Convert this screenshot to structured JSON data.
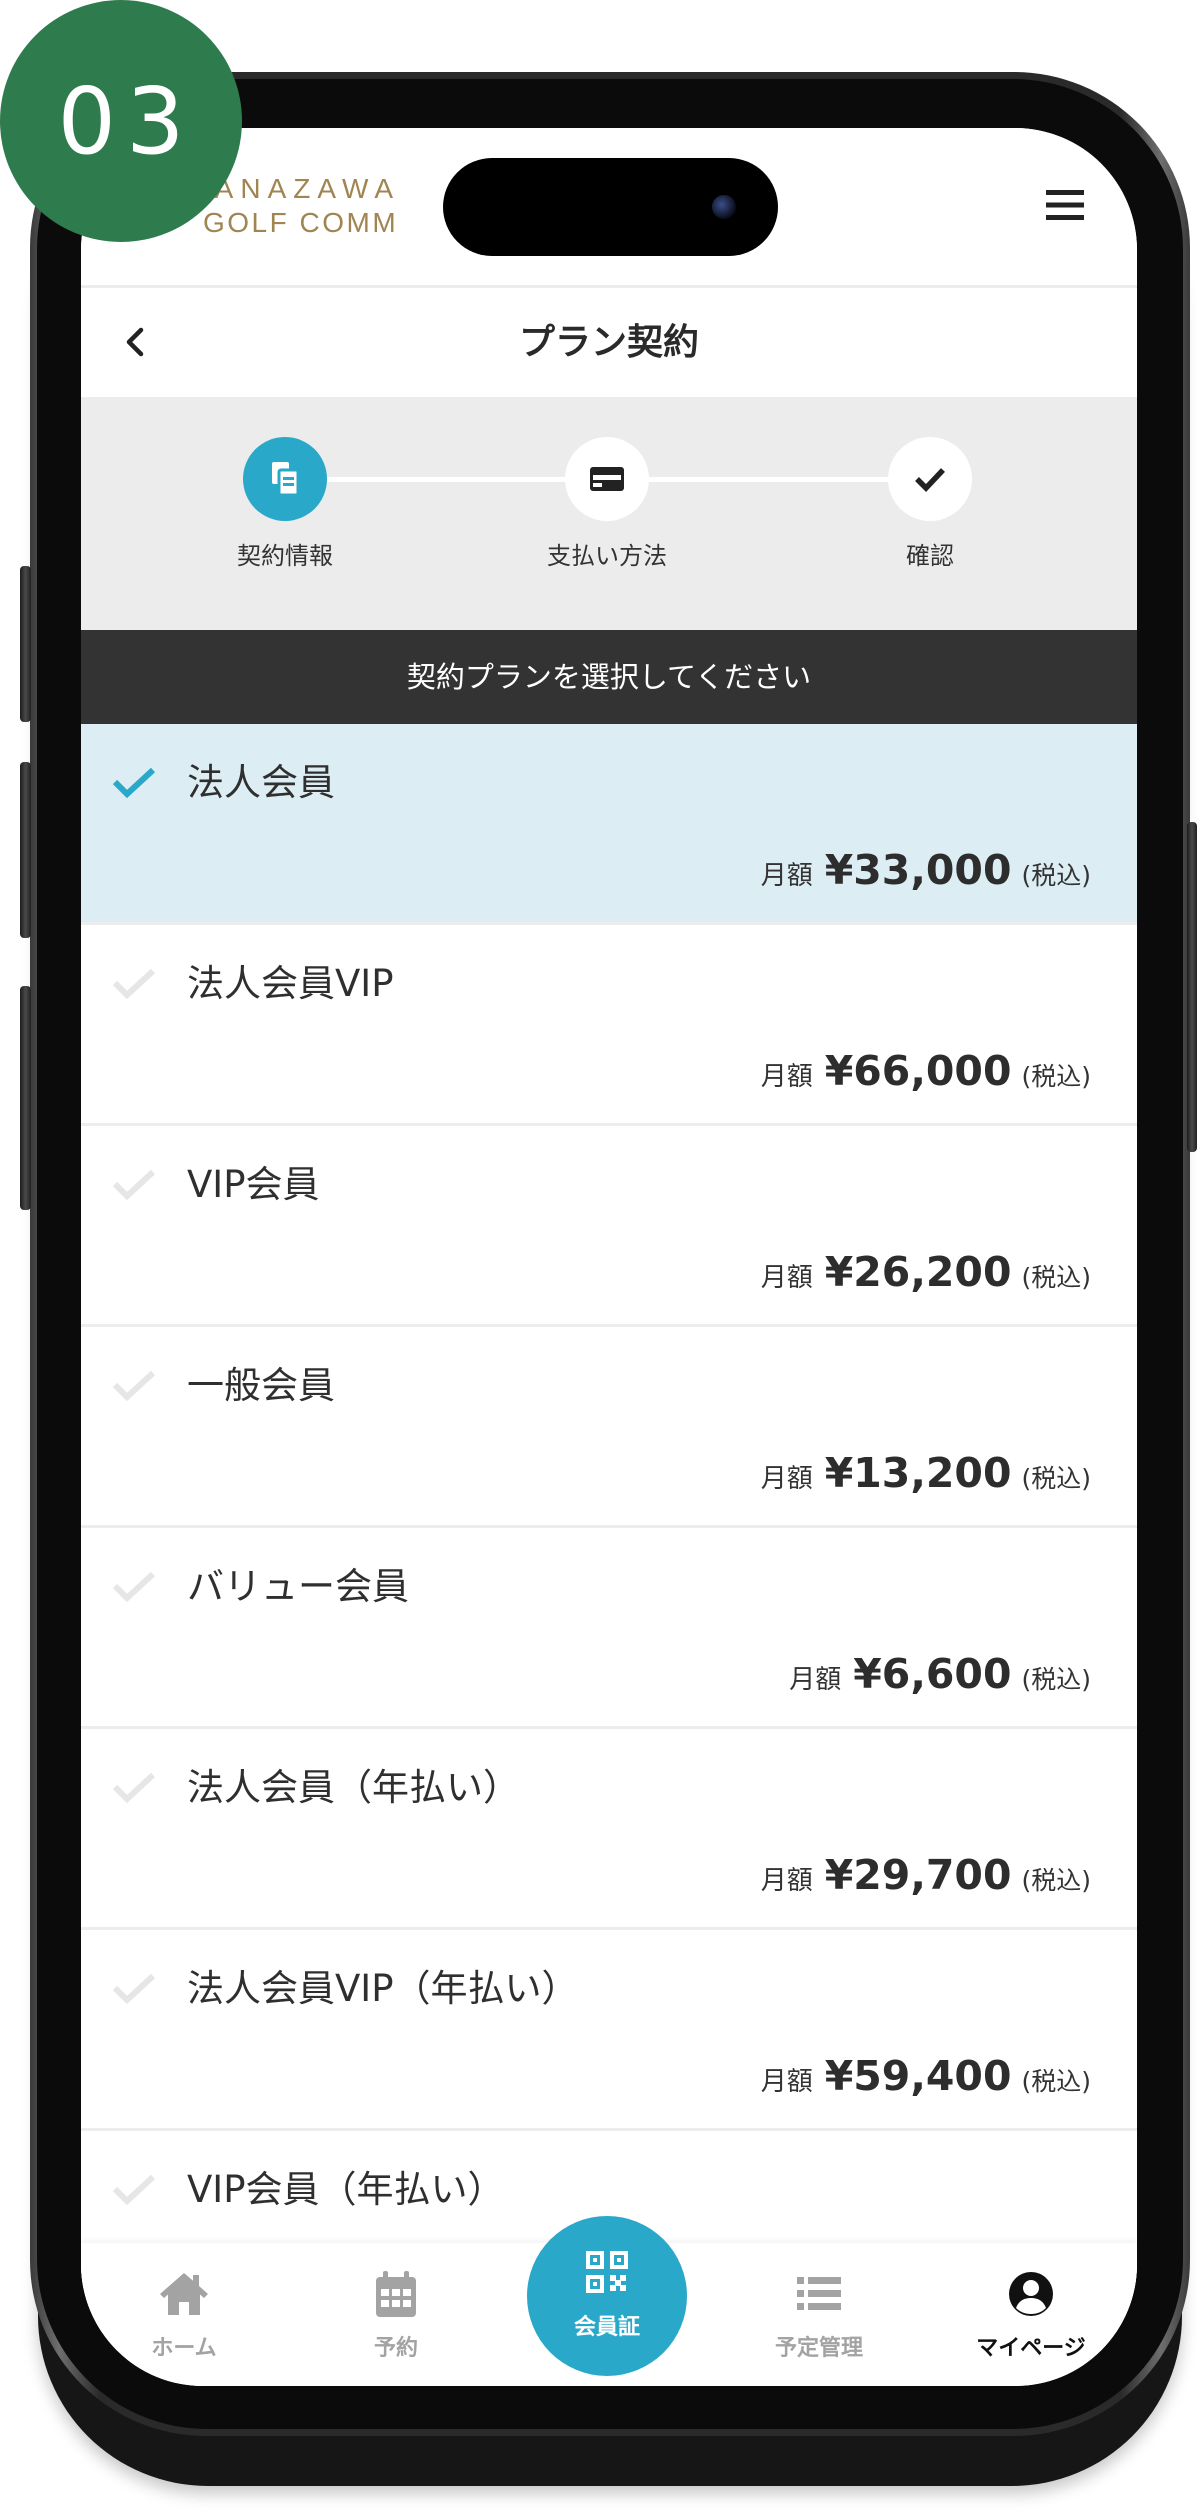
{
  "badge": {
    "number": "03"
  },
  "theme": {
    "accent": "#29a8ca",
    "selected_row_bg": "#dcedf4",
    "banner_bg": "#333333",
    "badge_color": "#2e7b4d",
    "logo_color": "#a08551",
    "inactive_nav": "#a3a3a3"
  },
  "header": {
    "logo_line1": "KANAZAWA",
    "logo_line2": "GOLF COMM",
    "menu_icon": "hamburger-menu-icon"
  },
  "title_bar": {
    "back_icon": "chevron-left-icon",
    "title": "プラン契約"
  },
  "stepper": {
    "steps": [
      {
        "label": "契約情報",
        "icon": "clipboard-icon",
        "state": "active"
      },
      {
        "label": "支払い方法",
        "icon": "credit-card-icon",
        "state": "pending"
      },
      {
        "label": "確認",
        "icon": "check-icon",
        "state": "pending"
      }
    ]
  },
  "banner": {
    "text": "契約プランを選択してください"
  },
  "plans": [
    {
      "name": "法人会員",
      "price_prefix": "月額",
      "price": "¥33,000",
      "tax_note": "(税込)",
      "selected": true
    },
    {
      "name": "法人会員VIP",
      "price_prefix": "月額",
      "price": "¥66,000",
      "tax_note": "(税込)",
      "selected": false
    },
    {
      "name": "VIP会員",
      "price_prefix": "月額",
      "price": "¥26,200",
      "tax_note": "(税込)",
      "selected": false
    },
    {
      "name": "一般会員",
      "price_prefix": "月額",
      "price": "¥13,200",
      "tax_note": "(税込)",
      "selected": false
    },
    {
      "name": "バリュー会員",
      "price_prefix": "月額",
      "price": "¥6,600",
      "tax_note": "(税込)",
      "selected": false
    },
    {
      "name": "法人会員（年払い）",
      "price_prefix": "月額",
      "price": "¥29,700",
      "tax_note": "(税込)",
      "selected": false
    },
    {
      "name": "法人会員VIP（年払い）",
      "price_prefix": "月額",
      "price": "¥59,400",
      "tax_note": "(税込)",
      "selected": false
    },
    {
      "name": "VIP会員（年払い）",
      "selected": false
    }
  ],
  "bottom_nav": {
    "active_index": 4,
    "items": [
      {
        "label": "ホーム",
        "icon": "home-icon"
      },
      {
        "label": "予約",
        "icon": "calendar-icon"
      },
      {
        "label": "会員証",
        "icon": "qr-code-icon"
      },
      {
        "label": "予定管理",
        "icon": "list-icon"
      },
      {
        "label": "マイページ",
        "icon": "user-circle-icon"
      }
    ]
  }
}
